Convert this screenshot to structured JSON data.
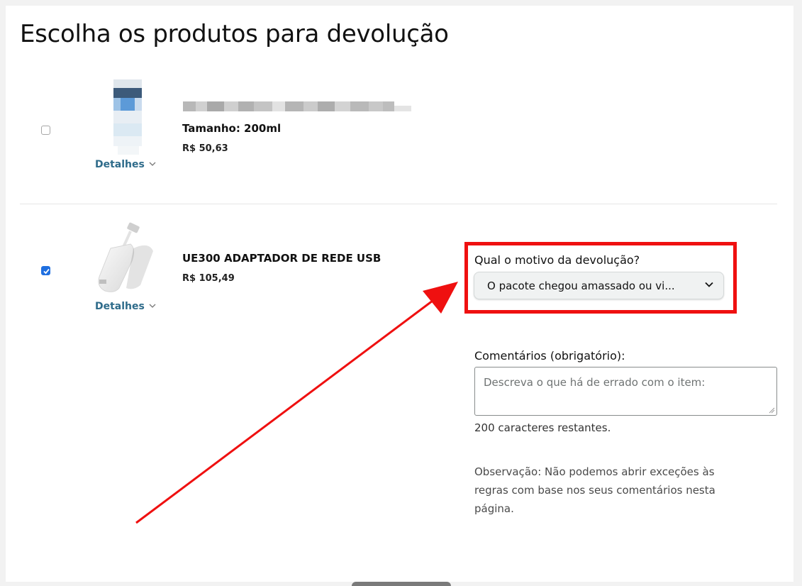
{
  "page": {
    "title": "Escolha os produtos para devolução"
  },
  "products": [
    {
      "name_blurred": true,
      "size": "Tamanho: 200ml",
      "price": "R$ 50,63",
      "details_link": "Detalhes",
      "checked": false
    },
    {
      "name": "UE300 ADAPTADOR DE REDE USB",
      "price": "R$ 105,49",
      "details_link": "Detalhes",
      "checked": true
    }
  ],
  "return_form": {
    "reason_label": "Qual o motivo da devolução?",
    "reason_selected": "O pacote chegou amassado ou vi...",
    "comments_label": "Comentários (obrigatório):",
    "comments_placeholder": "Descreva o que há de errado com o item:",
    "chars_remaining": "200 caracteres restantes.",
    "note": "Observação: Não podemos abrir exceções às regras com base nos seus comentários nesta página."
  },
  "colors": {
    "highlight_red": "#ef1010",
    "checkbox_blue": "#1f6fe0",
    "link_teal": "#2e6b8a"
  },
  "annotations": {
    "highlight_box": "red-rectangle",
    "arrow": "red-arrow"
  }
}
